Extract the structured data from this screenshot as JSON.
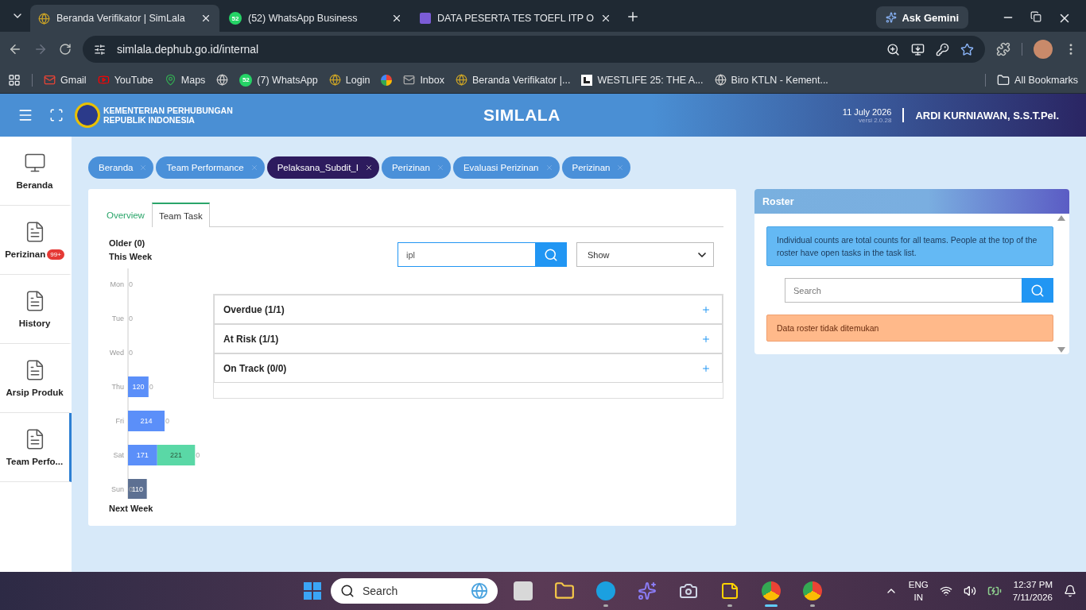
{
  "browser": {
    "tabs": [
      {
        "title": "Beranda Verifikator | SimLala",
        "selected": true,
        "kind": "site"
      },
      {
        "title": "(52) WhatsApp Business",
        "selected": false,
        "kind": "whatsapp",
        "badge": "52"
      },
      {
        "title": "DATA PESERTA TES TOEFL ITP O",
        "selected": false,
        "kind": "sheet"
      }
    ],
    "ask_button": "Ask Gemini",
    "url": "simlala.dephub.go.id/internal",
    "bookmarks": [
      {
        "kind": "gmail",
        "label": "Gmail"
      },
      {
        "kind": "youtube",
        "label": "YouTube"
      },
      {
        "kind": "maps",
        "label": "Maps"
      },
      {
        "kind": "globe"
      },
      {
        "kind": "whatsapp",
        "badge": "52",
        "label": "(7) WhatsApp"
      },
      {
        "kind": "site",
        "label": "Login"
      },
      {
        "kind": "pinwheel"
      },
      {
        "kind": "mail",
        "label": "Inbox"
      },
      {
        "kind": "site",
        "label": "Beranda Verifikator |..."
      },
      {
        "kind": "letter",
        "label": "WESTLIFE 25: THE A..."
      },
      {
        "kind": "globe",
        "label": "Biro KTLN - Kement..."
      }
    ],
    "all_bookmarks": "All Bookmarks"
  },
  "header": {
    "org_line1": "KEMENTERIAN PERHUBUNGAN",
    "org_line2": "REPUBLIK INDONESIA",
    "title": "SIMLALA",
    "date": "11 July 2026",
    "version": "versi 2.0.28",
    "user": "ARDI KURNIAWAN, S.S.T.Pel."
  },
  "sidebar": {
    "items": [
      {
        "label": "Beranda",
        "kind": "monitor",
        "selected": false
      },
      {
        "label": "Perizinan",
        "kind": "document",
        "badge": "99+",
        "selected": false
      },
      {
        "label": "History",
        "kind": "document",
        "selected": false
      },
      {
        "label": "Arsip Produk",
        "kind": "document",
        "selected": false
      },
      {
        "label": "Team Perfo...",
        "kind": "document",
        "selected": true
      }
    ]
  },
  "breadcrumbs": [
    {
      "label": "Beranda",
      "selected": false
    },
    {
      "label": "Team Performance",
      "selected": false
    },
    {
      "label": "Pelaksana_Subdit_I",
      "selected": true
    },
    {
      "label": "Perizinan",
      "selected": false
    },
    {
      "label": "Evaluasi Perizinan",
      "selected": false
    },
    {
      "label": "Perizinan",
      "selected": false
    }
  ],
  "card": {
    "tabs": [
      {
        "label": "Overview",
        "selected": false
      },
      {
        "label": "Team Task",
        "selected": true
      }
    ],
    "older": "Older (0)",
    "this_week": "This Week",
    "next_week": "Next Week",
    "chart_data": {
      "type": "bar",
      "orientation": "horizontal",
      "stacked": true,
      "categories": [
        "Mon",
        "Tue",
        "Wed",
        "Thu",
        "Fri",
        "Sat",
        "Sun"
      ],
      "series": [
        {
          "color": "#5b8ff9",
          "values": [
            0,
            0,
            0,
            120,
            214,
            171,
            0
          ]
        },
        {
          "color": "#5ad8a6",
          "values": [
            null,
            null,
            null,
            0,
            0,
            221,
            null
          ]
        },
        {
          "color": "#5d7092",
          "values": [
            null,
            null,
            null,
            null,
            null,
            0,
            110
          ]
        }
      ],
      "data_labels": true
    },
    "search": {
      "value": "ipl"
    },
    "filter": {
      "value": "Show"
    },
    "groups": [
      {
        "title": "Overdue (1/1)",
        "expanded": false
      },
      {
        "title": "At Risk (1/1)",
        "expanded": false
      },
      {
        "title": "On Track (0/0)",
        "expanded": false
      }
    ]
  },
  "roster": {
    "title": "Roster",
    "info": "Individual counts are total counts for all teams. People at the top of the roster have open tasks in the task list.",
    "search": {
      "placeholder": "Search"
    },
    "empty": "Data roster tidak ditemukan"
  },
  "taskbar": {
    "search": {
      "placeholder": "Search"
    },
    "apps": [
      {
        "kind": "taskview",
        "running": false,
        "selected": false
      },
      {
        "kind": "explorer",
        "running": false,
        "selected": false
      },
      {
        "kind": "edge",
        "running": true,
        "selected": false
      },
      {
        "kind": "copilot",
        "running": false,
        "selected": false
      },
      {
        "kind": "camera",
        "running": false,
        "selected": false
      },
      {
        "kind": "notes",
        "running": true,
        "selected": false
      },
      {
        "kind": "chrome",
        "running": true,
        "selected": true
      },
      {
        "kind": "chrome",
        "running": true,
        "selected": false
      }
    ],
    "language": "ENG",
    "region": "IN",
    "time": "12:37 PM",
    "date": "7/11/2026"
  }
}
